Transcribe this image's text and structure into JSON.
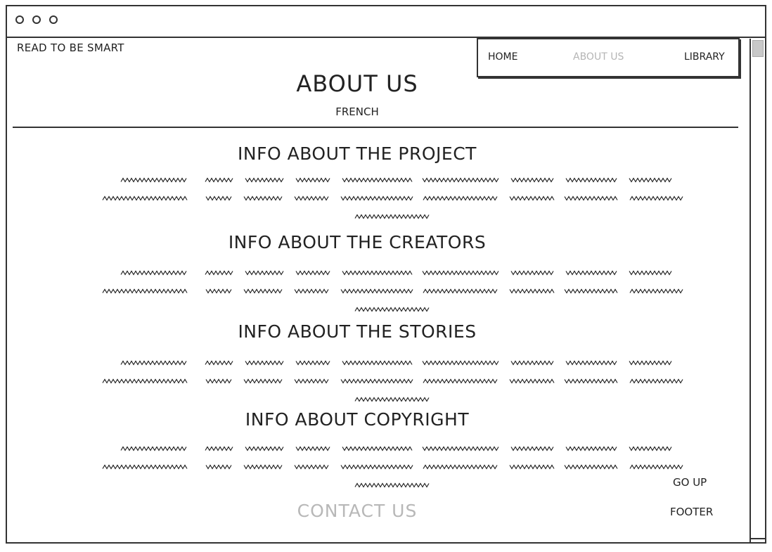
{
  "header": {
    "brand": "READ TO BE SMART"
  },
  "nav": {
    "items": [
      {
        "label": "HOME",
        "active": false
      },
      {
        "label": "ABOUT US",
        "active": true
      },
      {
        "label": "LIBRARY",
        "active": false
      }
    ]
  },
  "page": {
    "title": "ABOUT US",
    "subtitle": "FRENCH"
  },
  "sections": [
    {
      "title": "INFO ABOUT THE PROJECT"
    },
    {
      "title": "INFO ABOUT THE CREATORS"
    },
    {
      "title": "INFO ABOUT THE STORIES"
    },
    {
      "title": "INFO ABOUT COPYRIGHT"
    }
  ],
  "footer": {
    "go_up": "GO UP",
    "label": "FOOTER",
    "contact": "CONTACT US"
  },
  "colors": {
    "ink": "#222222",
    "muted": "#b5b5b5"
  }
}
